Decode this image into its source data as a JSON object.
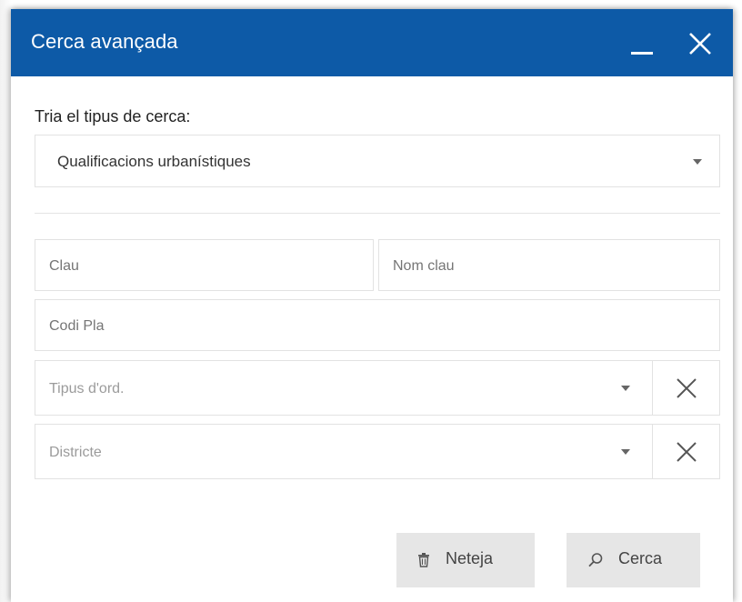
{
  "window": {
    "title": "Cerca avançada",
    "header_color": "#0d5aa7",
    "minimize_icon": "minimize-icon",
    "close_icon": "close-icon"
  },
  "search_type": {
    "label": "Tria el tipus de cerca:",
    "selected": "Qualificacions urbanístiques"
  },
  "fields": {
    "clau": {
      "placeholder": "Clau"
    },
    "nom_clau": {
      "placeholder": "Nom clau"
    },
    "codi_pla": {
      "placeholder": "Codi Pla"
    },
    "tipus_ord": {
      "placeholder": "Tipus d'ord."
    },
    "districte": {
      "placeholder": "Districte"
    }
  },
  "actions": {
    "clear_label": "Neteja",
    "clear_icon": "trash-icon",
    "search_label": "Cerca",
    "search_icon": "search-icon"
  }
}
